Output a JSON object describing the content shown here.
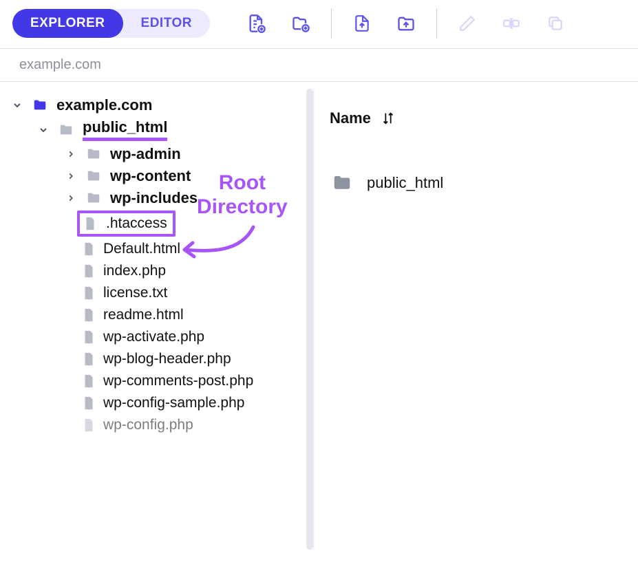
{
  "tabs": {
    "explorer": "EXPLORER",
    "editor": "EDITOR"
  },
  "breadcrumb": "example.com",
  "tree": {
    "root": "example.com",
    "public_html": "public_html",
    "folders": [
      "wp-admin",
      "wp-content",
      "wp-includes"
    ],
    "files": [
      ".htaccess",
      "Default.html",
      "index.php",
      "license.txt",
      "readme.html",
      "wp-activate.php",
      "wp-blog-header.php",
      "wp-comments-post.php",
      "wp-config-sample.php",
      "wp-config.php"
    ]
  },
  "main": {
    "col_name": "Name",
    "item": "public_html"
  },
  "annotation": "Root\nDirectory",
  "colors": {
    "accent": "#4338e8",
    "highlight": "#a855f7",
    "folder_active": "#4338e8",
    "folder_muted": "#b7bbc7",
    "file_muted": "#b7bbc7"
  }
}
